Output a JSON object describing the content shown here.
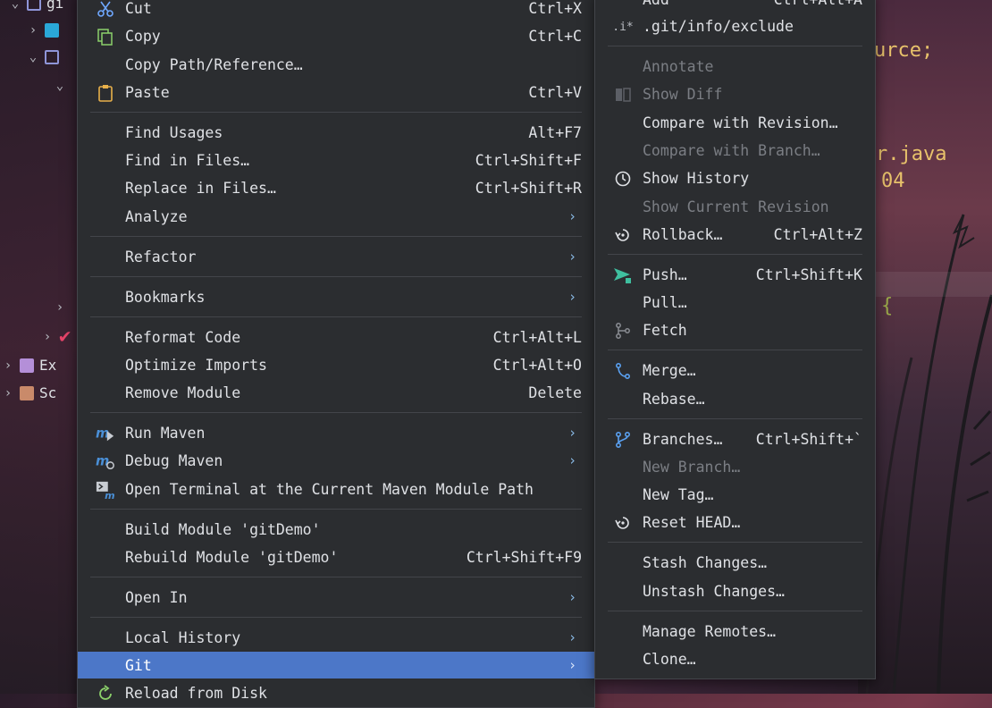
{
  "colors": {
    "menu_bg": "#2b2d30",
    "separator": "#43454a",
    "selected": "#4c77c8",
    "text": "#dfe1e5",
    "disabled_text": "#7b7e84",
    "submenu_arrow": "#8bbce8"
  },
  "editor": {
    "frag1": "urce;",
    "frag2": "r.java",
    "frag3": "04",
    "frag4": "{"
  },
  "tree": {
    "item_top": "gi",
    "item_ext": "Ex",
    "item_sc": "Sc"
  },
  "context_menu": {
    "items": [
      {
        "label": "Cut",
        "shortcut": "Ctrl+X",
        "icon": "scissors-icon"
      },
      {
        "label": "Copy",
        "shortcut": "Ctrl+C",
        "icon": "copy-icon"
      },
      {
        "label": "Copy Path/Reference…",
        "shortcut": ""
      },
      {
        "label": "Paste",
        "shortcut": "Ctrl+V",
        "icon": "clipboard-icon"
      },
      {
        "label": "Find Usages",
        "shortcut": "Alt+F7"
      },
      {
        "label": "Find in Files…",
        "shortcut": "Ctrl+Shift+F"
      },
      {
        "label": "Replace in Files…",
        "shortcut": "Ctrl+Shift+R"
      },
      {
        "label": "Analyze",
        "submenu": true
      },
      {
        "label": "Refactor",
        "submenu": true
      },
      {
        "label": "Bookmarks",
        "submenu": true
      },
      {
        "label": "Reformat Code",
        "shortcut": "Ctrl+Alt+L"
      },
      {
        "label": "Optimize Imports",
        "shortcut": "Ctrl+Alt+O"
      },
      {
        "label": "Remove Module",
        "shortcut": "Delete"
      },
      {
        "label": "Run Maven",
        "submenu": true,
        "icon": "maven-run-icon"
      },
      {
        "label": "Debug Maven",
        "submenu": true,
        "icon": "maven-debug-icon"
      },
      {
        "label": "Open Terminal at the Current Maven Module Path",
        "icon": "maven-terminal-icon"
      },
      {
        "label": "Build Module 'gitDemo'",
        "shortcut": ""
      },
      {
        "label": "Rebuild Module 'gitDemo'",
        "shortcut": "Ctrl+Shift+F9"
      },
      {
        "label": "Open In",
        "submenu": true
      },
      {
        "label": "Local History",
        "submenu": true
      },
      {
        "label": "Git",
        "submenu": true,
        "selected": true
      },
      {
        "label": "Reload from Disk",
        "icon": "reload-icon"
      }
    ]
  },
  "git_menu": {
    "items": [
      {
        "label": "Add",
        "shortcut": "Ctrl+Alt+A"
      },
      {
        "label": ".git/info/exclude",
        "icon": "git-ignore-icon"
      },
      {
        "label": "Annotate",
        "disabled": true
      },
      {
        "label": "Show Diff",
        "disabled": true,
        "icon": "diff-icon"
      },
      {
        "label": "Compare with Revision…"
      },
      {
        "label": "Compare with Branch…",
        "disabled": true
      },
      {
        "label": "Show History",
        "icon": "history-icon"
      },
      {
        "label": "Show Current Revision",
        "disabled": true
      },
      {
        "label": "Rollback…",
        "shortcut": "Ctrl+Alt+Z",
        "icon": "rollback-icon"
      },
      {
        "label": "Push…",
        "shortcut": "Ctrl+Shift+K",
        "icon": "push-icon"
      },
      {
        "label": "Pull…"
      },
      {
        "label": "Fetch",
        "icon": "fetch-icon"
      },
      {
        "label": "Merge…",
        "icon": "merge-icon"
      },
      {
        "label": "Rebase…"
      },
      {
        "label": "Branches…",
        "shortcut": "Ctrl+Shift+`",
        "icon": "branch-icon"
      },
      {
        "label": "New Branch…",
        "disabled": true
      },
      {
        "label": "New Tag…"
      },
      {
        "label": "Reset HEAD…",
        "icon": "reset-icon"
      },
      {
        "label": "Stash Changes…"
      },
      {
        "label": "Unstash Changes…"
      },
      {
        "label": "Manage Remotes…"
      },
      {
        "label": "Clone…"
      }
    ]
  }
}
